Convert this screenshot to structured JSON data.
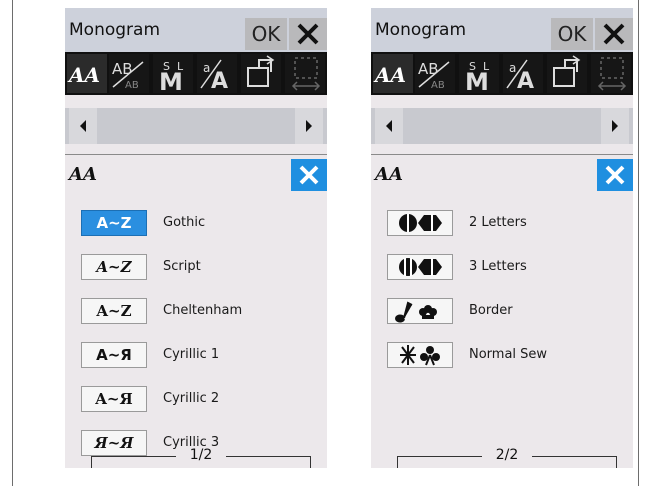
{
  "screens": [
    {
      "title": "Monogram",
      "ok_label": "OK",
      "section_icon": "font-style-icon",
      "items": [
        {
          "button": "A~Z",
          "label": "Gothic",
          "selected": true,
          "style": "sans"
        },
        {
          "button": "A~Z",
          "label": "Script",
          "selected": false,
          "style": "script"
        },
        {
          "button": "A~Z",
          "label": "Cheltenham",
          "selected": false,
          "style": "serif"
        },
        {
          "button": "A~Я",
          "label": "Cyrillic 1",
          "selected": false,
          "style": "sans"
        },
        {
          "button": "A~Я",
          "label": "Cyrillic 2",
          "selected": false,
          "style": "serif"
        },
        {
          "button": "Я~Я",
          "label": "Cyrillic 3",
          "selected": false,
          "style": "script"
        }
      ],
      "page": "1/2"
    },
    {
      "title": "Monogram",
      "ok_label": "OK",
      "section_icon": "font-style-icon",
      "items": [
        {
          "label": "2 Letters",
          "icon": "two-letter-monogram-icon"
        },
        {
          "label": "3 Letters",
          "icon": "three-letter-monogram-icon"
        },
        {
          "label": "Border",
          "icon": "border-pattern-icon"
        },
        {
          "label": "Normal Sew",
          "icon": "normal-sew-icon"
        }
      ],
      "page": "2/2"
    }
  ],
  "toolbar_icons": [
    "font-style-icon",
    "letter-size-icon",
    "letter-layout-icon",
    "case-icon",
    "rotate-icon",
    "spacing-icon"
  ],
  "colors": {
    "accent": "#2a8fe0",
    "titlebar": "#cdd1db",
    "toolbar": "#101010",
    "panel": "#ece8eb"
  }
}
